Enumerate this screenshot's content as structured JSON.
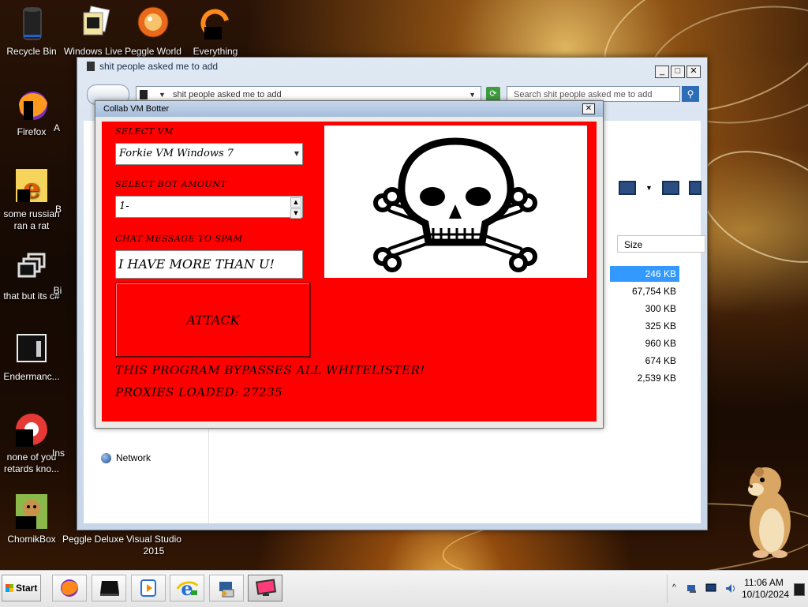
{
  "desktop": {
    "icons": [
      {
        "label": "Recycle Bin"
      },
      {
        "label": "Windows Live"
      },
      {
        "label": "Peggle World"
      },
      {
        "label": "Everything"
      },
      {
        "label": "Firefox"
      },
      {
        "label": "some russian ran a rat"
      },
      {
        "label": "that but its c#"
      },
      {
        "label": "Endermanc..."
      },
      {
        "label": "none of you retards kno..."
      },
      {
        "label": "ChomikBox"
      },
      {
        "label": "Peggle Deluxe"
      },
      {
        "label": "Visual Studio 2015"
      }
    ],
    "partial_labels": [
      "A",
      "B",
      "Bi",
      "Ins"
    ]
  },
  "explorer": {
    "title": "shit people asked me to add",
    "address": "shit people asked me to add",
    "search_placeholder": "Search shit people asked me to add",
    "column_size": "Size",
    "sizes": [
      "246 KB",
      "67,754 KB",
      "300 KB",
      "325 KB",
      "960 KB",
      "674 KB",
      "2,539 KB"
    ],
    "nav_network": "Network",
    "buttons": {
      "minimize": "_",
      "maximize": "□",
      "close": "✕"
    }
  },
  "bot": {
    "title": "Collab VM Botter",
    "close": "✕",
    "select_vm_label": "SELECT VM",
    "select_vm_value": "Forkie VM Windows 7",
    "select_bot_label": "SELECT BOT AMOUNT",
    "bot_amount_value": "1-",
    "chat_label": "CHAT MESSAGE TO SPAM",
    "chat_value": "I HAVE MORE THAN U!",
    "attack_label": "ATTACK",
    "notice_1": "THIS PROGRAM BYPASSES ALL WHITELISTER!",
    "notice_2": "PROXIES LOADED: 27235"
  },
  "taskbar": {
    "start_label": "Start",
    "clock_time": "11:06 AM",
    "clock_date": "10/10/2024",
    "tray_expand": "^"
  },
  "colors": {
    "bot_background": "#ff0000",
    "selection": "#3399ff",
    "titlebar": "#a6bedb"
  }
}
